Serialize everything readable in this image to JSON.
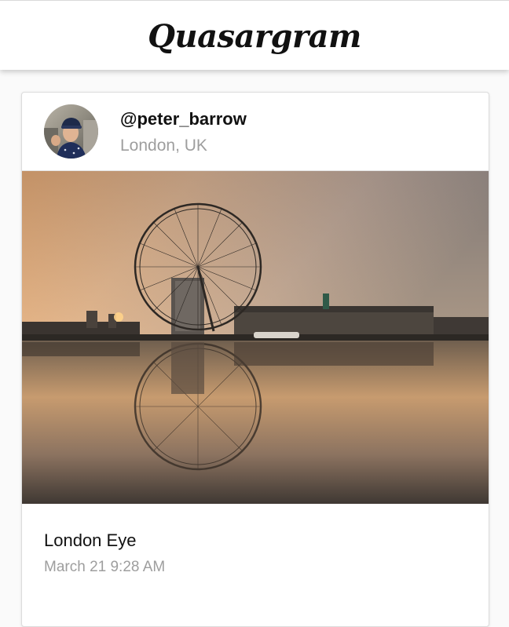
{
  "app": {
    "title": "Quasargram"
  },
  "post": {
    "username": "@peter_barrow",
    "location": "London, UK",
    "photo_subject": "london-eye-reflection-photo",
    "caption": "London Eye",
    "timestamp": "March 21 9:28 AM"
  },
  "colors": {
    "header_bg": "#ffffff",
    "page_bg": "#fafafa",
    "secondary_text": "#9e9e9e",
    "primary_text": "#111111"
  }
}
